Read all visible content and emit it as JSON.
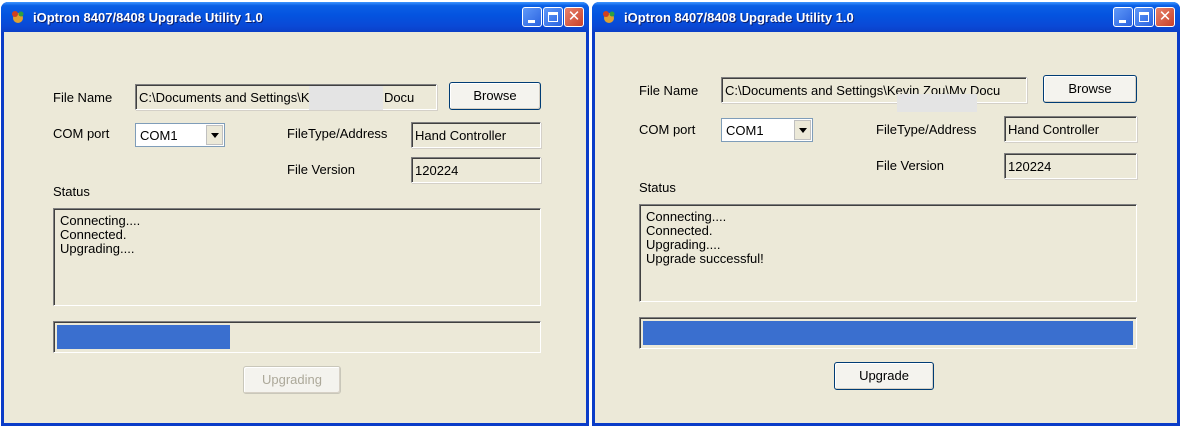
{
  "windows": [
    {
      "title": "iOptron 8407/8408 Upgrade Utility 1.0",
      "labels": {
        "file_name": "File Name",
        "com_port": "COM port",
        "file_type": "FileType/Address",
        "file_version": "File Version",
        "status": "Status"
      },
      "file_name_value": "C:\\Documents and Settings\\Kevin Zou\\My Docu",
      "browse_label": "Browse",
      "com_port_value": "COM1",
      "file_type_value": "Hand Controller",
      "file_version_value": "120224",
      "status_lines": [
        "Connecting....",
        "Connected.",
        "Upgrading...."
      ],
      "progress": 0.36,
      "action_button": "Upgrading",
      "action_enabled": false
    },
    {
      "title": "iOptron 8407/8408 Upgrade Utility 1.0",
      "labels": {
        "file_name": "File Name",
        "com_port": "COM port",
        "file_type": "FileType/Address",
        "file_version": "File Version",
        "status": "Status"
      },
      "file_name_value": "C:\\Documents and Settings\\Kevin Zou\\My Docu",
      "browse_label": "Browse",
      "com_port_value": "COM1",
      "file_type_value": "Hand Controller",
      "file_version_value": "120224",
      "status_lines": [
        "Connecting....",
        "Connected.",
        "Upgrading....",
        "Upgrade successful!"
      ],
      "progress": 1.0,
      "action_button": "Upgrade",
      "action_enabled": true
    }
  ]
}
